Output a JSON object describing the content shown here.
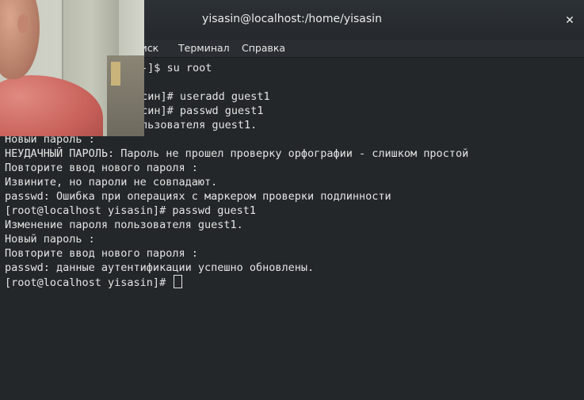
{
  "window": {
    "title": "yisasin@localhost:/home/yisasin",
    "close_glyph": "✕"
  },
  "menu": {
    "items": [
      "оиск",
      "Терминал",
      "Справка"
    ]
  },
  "terminal": {
    "lines": [
      "-]$ su root",
      "",
      "асин]# useradd guest1",
      "асин]# passwd guest1",
      "льзователя guest1.",
      "Новый пароль :",
      "НЕУДАЧНЫЙ ПАРОЛЬ: Пароль не прошел проверку орфографии - слишком простой",
      "Повторите ввод нового пароля :",
      "Извините, но пароли не совпадают.",
      "passwd: Ошибка при операциях с маркером проверки подлинности",
      "[root@localhost yisasin]# passwd guest1",
      "Изменение пароля пользователя guest1.",
      "Новый пароль :",
      "Повторите ввод нового пароля :",
      "passwd: данные аутентификации успешно обновлены.",
      "[root@localhost yisasin]# "
    ]
  },
  "icons": {
    "close": "close-icon",
    "cursor": "text-cursor-icon"
  }
}
